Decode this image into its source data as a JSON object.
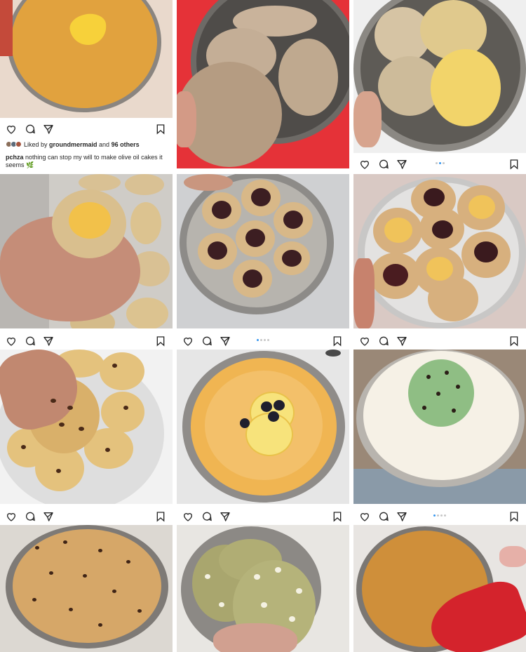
{
  "post1": {
    "likes_prefix": "Liked by ",
    "likes_user": "groundmermaid",
    "likes_and": " and ",
    "likes_count": "96 others",
    "caption_user": "pchza",
    "caption_text": " nothing can stop my will to make olive oil cakes it seems 🌿"
  },
  "photos": [
    {
      "subject": "olive oil cake with heart-shaped mango",
      "colors": {
        "bg": "#e9d9cc",
        "main": "#e1a23e",
        "accent": "#f7d13a"
      }
    },
    {
      "subject": "oat cookies in pan",
      "colors": {
        "bg": "#e53238",
        "main": "#c9b39b",
        "accent": "#b59c82"
      }
    },
    {
      "subject": "cookies in pan",
      "colors": {
        "bg": "#efefef",
        "main": "#d6c4a4",
        "accent": "#f2d46a"
      }
    },
    {
      "subject": "lemon curd thumbprint cookie in hand",
      "colors": {
        "bg": "#b9b6b2",
        "main": "#d9bf8e",
        "accent": "#f2c14a"
      }
    },
    {
      "subject": "jam thumbprint cookies in pan",
      "colors": {
        "bg": "#cfd0d2",
        "main": "#d8b888",
        "accent": "#3c1e22"
      }
    },
    {
      "subject": "lemon and jam thumbprint cookies",
      "colors": {
        "bg": "#d9c9c4",
        "main": "#d7b07e",
        "accent": "#f0c35a"
      }
    },
    {
      "subject": "chocolate chip cookies",
      "colors": {
        "bg": "#f2f2f2",
        "main": "#e4c27d",
        "accent": "#4a2a18"
      }
    },
    {
      "subject": "lemon blueberry coconut cake",
      "colors": {
        "bg": "#e6e6e6",
        "main": "#f0b552",
        "accent": "#f7e37b"
      }
    },
    {
      "subject": "mint chocolate chip pie",
      "colors": {
        "bg": "#9a8877",
        "main": "#f6f1e6",
        "accent": "#8fbe84"
      }
    },
    {
      "subject": "chocolate chip cookie cake",
      "colors": {
        "bg": "#dcd8d2",
        "main": "#d6a768",
        "accent": "#3f2416"
      }
    },
    {
      "subject": "matcha white chocolate cookies",
      "colors": {
        "bg": "#e8e6e2",
        "main": "#b5b37a",
        "accent": "#f4f1e2"
      }
    },
    {
      "subject": "olive oil cake with red oven mitt",
      "colors": {
        "bg": "#cfc9c3",
        "main": "#cf8f3a",
        "accent": "#d4232c"
      }
    }
  ],
  "colors": {
    "icon": "#262626",
    "dot": "#c7c7c7",
    "dot_active": "#3897f0"
  },
  "icons": [
    "heart-icon",
    "comment-icon",
    "share-icon",
    "bookmark-icon"
  ]
}
